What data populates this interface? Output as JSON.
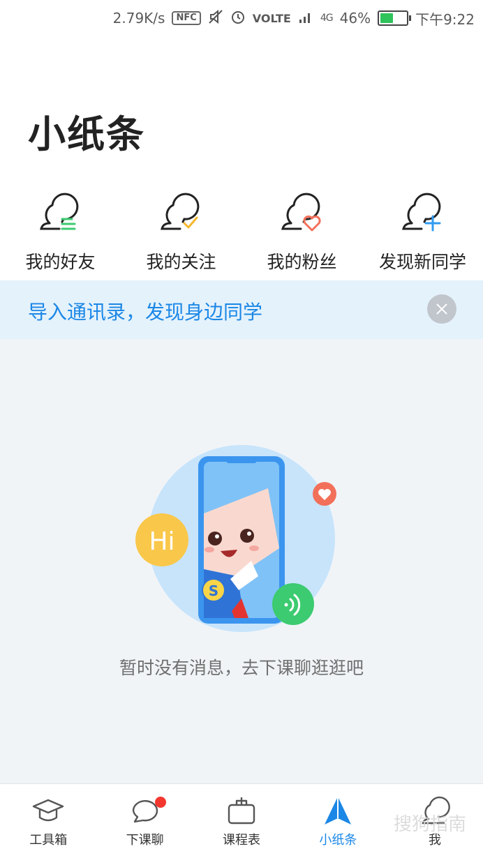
{
  "status_bar": {
    "speed": "2.79K/s",
    "nfc": "NFC",
    "volte": "VOLTE",
    "network": "4G",
    "battery": "46%",
    "battery_level": 0.46,
    "time": "下午9:22"
  },
  "page": {
    "title": "小纸条"
  },
  "actions": [
    {
      "label": "我的好友",
      "icon": "friends-list-icon",
      "accent": "#3ccb70"
    },
    {
      "label": "我的关注",
      "icon": "follow-check-icon",
      "accent": "#f5b82e"
    },
    {
      "label": "我的粉丝",
      "icon": "fans-heart-icon",
      "accent": "#f2705a"
    },
    {
      "label": "发现新同学",
      "icon": "add-classmate-icon",
      "accent": "#2f9bf0"
    }
  ],
  "banner": {
    "text": "导入通讯录，发现身边同学"
  },
  "empty_state": {
    "hi_text": "Hi",
    "badge_letter": "S",
    "message": "暂时没有消息，去下课聊逛逛吧"
  },
  "tabs": [
    {
      "label": "工具箱",
      "icon": "graduation-cap-icon",
      "active": false
    },
    {
      "label": "下课聊",
      "icon": "chat-bubble-icon",
      "active": false,
      "badge": true
    },
    {
      "label": "课程表",
      "icon": "schedule-bag-icon",
      "active": false
    },
    {
      "label": "小纸条",
      "icon": "paper-plane-icon",
      "active": true
    },
    {
      "label": "我",
      "icon": "profile-icon",
      "active": false
    }
  ],
  "colors": {
    "accent": "#1b87e6",
    "badge": "#f2372e",
    "background": "#f1f4f7"
  },
  "watermark": "搜狗指南"
}
